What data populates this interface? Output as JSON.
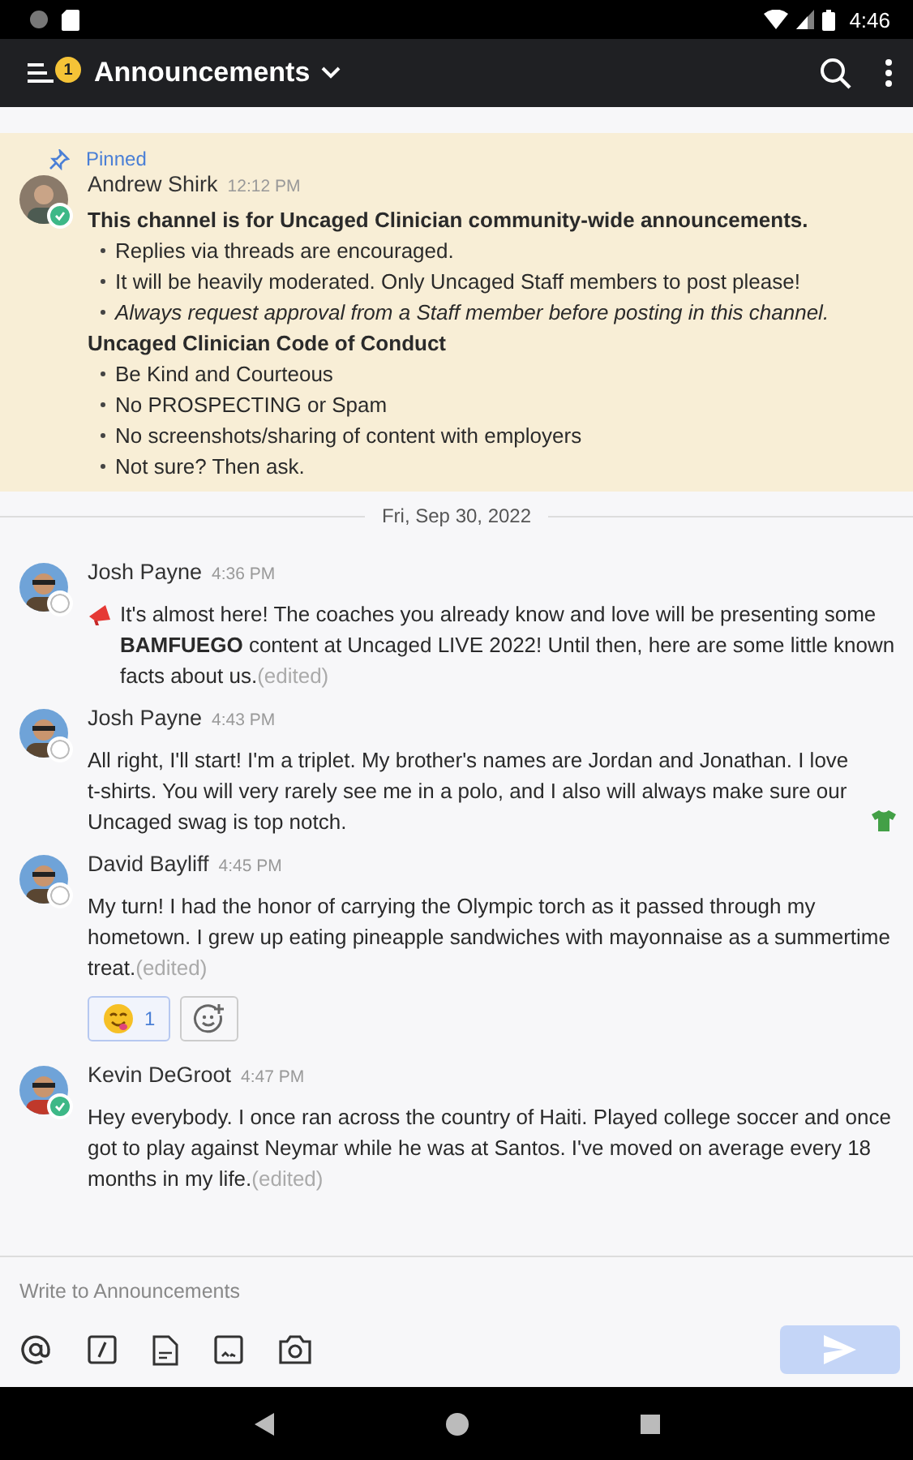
{
  "status_bar": {
    "time": "4:46"
  },
  "header": {
    "title": "Announcements",
    "badge": "1"
  },
  "pinned": {
    "label": "Pinned",
    "author": "Andrew Shirk",
    "time": "12:12 PM",
    "online": true,
    "blocks": [
      {
        "kind": "heading",
        "text": "This channel is for Uncaged Clinician community-wide announcements.",
        "italic": false
      },
      {
        "kind": "bullet",
        "text": "Replies via threads are encouraged.",
        "italic": false
      },
      {
        "kind": "bullet",
        "text": "It will be heavily moderated. Only Uncaged Staff members to post please!",
        "italic": false
      },
      {
        "kind": "bullet",
        "text": "Always request approval from a Staff member before posting in this channel.",
        "italic": true
      },
      {
        "kind": "heading",
        "text": "Uncaged Clinician Code of Conduct",
        "italic": false
      },
      {
        "kind": "bullet",
        "text": "Be Kind and Courteous",
        "italic": false
      },
      {
        "kind": "bullet",
        "text": "No PROSPECTING or Spam",
        "italic": false
      },
      {
        "kind": "bullet",
        "text": "No screenshots/sharing of content with employers",
        "italic": false
      },
      {
        "kind": "bullet",
        "text": "Not sure? Then ask.",
        "italic": false
      }
    ]
  },
  "date_divider": "Fri, Sep 30, 2022",
  "messages": [
    {
      "author": "Josh Payne",
      "time": "4:36 PM",
      "online": false,
      "megaphone": true,
      "text": "It's almost here! The coaches you already know and love will be presenting some **BAMFUEGO** content at Uncaged LIVE 2022! Until then, here are some little known facts about us.",
      "edited": "(edited)"
    },
    {
      "author": "Josh Payne",
      "time": "4:43 PM",
      "online": false,
      "shirt": true,
      "text": "All right, I'll start! I'm a triplet. My brother's names are Jordan and Jonathan. I love t-shirts. You will very rarely see me in a polo, and I also will always make sure our Uncaged swag is top notch."
    },
    {
      "author": "David Bayliff",
      "time": "4:45 PM",
      "online": false,
      "text": "My turn! I had the honor of carrying the Olympic torch as it passed through my hometown. I grew up eating pineapple sandwiches with mayonnaise as a summertime treat.",
      "edited": "(edited)",
      "reactions": [
        {
          "count": "1",
          "selected": true
        }
      ]
    },
    {
      "author": "Kevin DeGroot",
      "time": "4:47 PM",
      "online": true,
      "text": "Hey everybody. I once ran across the country of Haiti. Played college soccer and once got to play against Neymar while he was at Santos. I've moved on average every 18 months in my life.",
      "edited": "(edited)"
    }
  ],
  "composer": {
    "placeholder": "Write to Announcements",
    "send_disabled": true
  }
}
